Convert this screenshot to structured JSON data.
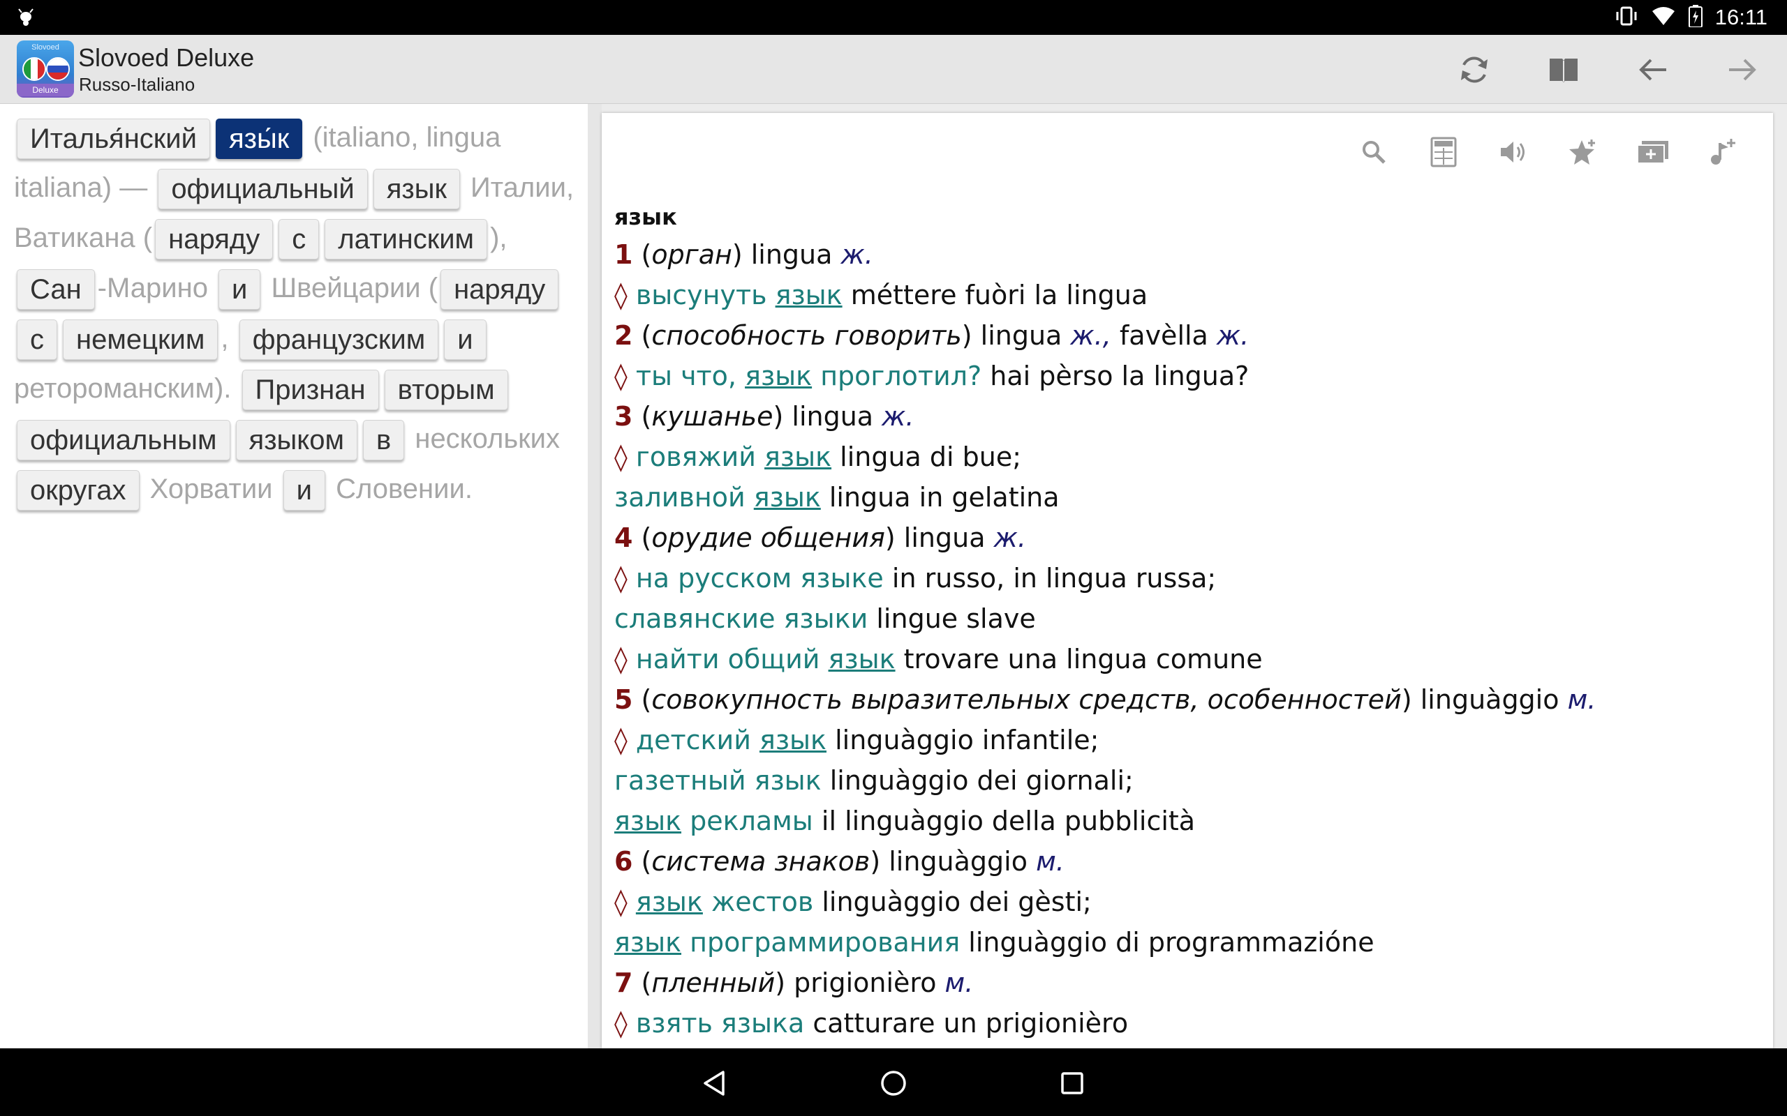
{
  "status_bar": {
    "time": "16:11"
  },
  "app_bar": {
    "icon_top_text": "Slovoed",
    "icon_bottom_text": "Deluxe",
    "title": "Slovoed Deluxe",
    "subtitle": "Russo-Italiano"
  },
  "source": {
    "t1": "Италья́нский",
    "t2": "язы́к",
    "t3": " (italiano, lingua italiana) — ",
    "t4": "официальный",
    "t5": "язык",
    "t6": " Италии, Ватикана (",
    "t7": "наряду",
    "t8": "с",
    "t9": "латинским",
    "t10": "), ",
    "t11": "Сан",
    "t12": "-Марино ",
    "t13": "и",
    "t14": " Швейцарии (",
    "t15": "наряду",
    "t16": "с",
    "t17": "немецким",
    "t18": ", ",
    "t19": "французским",
    "t20": "и",
    "t21": " ретороманским). ",
    "t22": "Признан",
    "t23": "вторым",
    "t24": "официальным",
    "t25": "языком",
    "t26": "в",
    "t27": " нескольких ",
    "t28": "округах",
    "t29": " Хорватии ",
    "t30": "и",
    "t31": " Словении."
  },
  "entry": {
    "headword": "язык",
    "l1": {
      "num": "1",
      "open": " (",
      "gloss": "орган",
      "close": ") lingua ",
      "gram": "ж."
    },
    "l2": {
      "dia": "◊ ",
      "ru1": "высунуть ",
      "ru_ul": "язык",
      "it": " méttere fuòri la lingua"
    },
    "l3": {
      "num": "2",
      "open": " (",
      "gloss": "способность говорить",
      "close": ") lingua ",
      "gram": "ж.,",
      "mid": " favèlla ",
      "gram2": "ж."
    },
    "l4": {
      "dia": "◊ ",
      "ru1": "ты что, ",
      "ru_ul": "язык",
      "ru2": " проглотил?",
      "it": " hai pèrso la lingua?"
    },
    "l5": {
      "num": "3",
      "open": " (",
      "gloss": "кушанье",
      "close": ") lingua ",
      "gram": "ж."
    },
    "l6": {
      "dia": "◊ ",
      "ru1": "говяжий ",
      "ru_ul": "язык",
      "it": " lingua di bue;"
    },
    "l7": {
      "ru1": "заливной ",
      "ru_ul": "язык",
      "it": " lingua in gelatina"
    },
    "l8": {
      "num": "4",
      "open": " (",
      "gloss": "орудие общения",
      "close": ") lingua ",
      "gram": "ж."
    },
    "l9": {
      "dia": "◊ ",
      "ru1": "на русском языке",
      "it": " in russo, in lingua russa;"
    },
    "l10": {
      "ru1": "славянские языки",
      "it": " lingue slave"
    },
    "l11": {
      "dia": "◊ ",
      "ru1": "найти общий ",
      "ru_ul": "язык",
      "it": " trovare una lingua comune"
    },
    "l12": {
      "num": "5",
      "open": " (",
      "gloss": "совокупность выразительных средств, особенностей",
      "close": ") linguàggio ",
      "gram": "м."
    },
    "l13": {
      "dia": "◊ ",
      "ru1": "детский ",
      "ru_ul": "язык",
      "it": " linguàggio infantile;"
    },
    "l14": {
      "ru1": "газетный язык",
      "it": " linguàggio dei giornali;"
    },
    "l15": {
      "ru_ul": "язык",
      "ru2": " рекламы",
      "it": " il linguàggio della pubblicità"
    },
    "l16": {
      "num": "6",
      "open": " (",
      "gloss": "система знаков",
      "close": ") linguàggio ",
      "gram": "м."
    },
    "l17": {
      "dia": "◊ ",
      "ru_ul": "язык",
      "ru2": " жестов",
      "it": " linguàggio dei gèsti;"
    },
    "l18": {
      "ru_ul": "язык",
      "ru2": " программирования",
      "it": " linguàggio di programmazióne"
    },
    "l19": {
      "num": "7",
      "open": " (",
      "gloss": "пленный",
      "close": ") prigionièro ",
      "gram": "м."
    },
    "l20": {
      "dia": "◊ ",
      "ru1": "взять языка",
      "it": " catturare un prigionièro"
    }
  },
  "colors": {
    "chip_active": "#0c3276",
    "sense_number": "#7b1010",
    "russian_phrase": "#1b7d7a",
    "grammar": "#1c1c6e",
    "dimmed_text": "#a6a6a6"
  },
  "icons": {
    "app_bar": [
      "sync-icon",
      "book-icon",
      "back-arrow-icon",
      "forward-arrow-icon"
    ],
    "toolbar": [
      "search-icon",
      "calculator-icon",
      "speaker-icon",
      "favorite-add-icon",
      "cards-add-icon",
      "music-note-add-icon"
    ],
    "navigation": [
      "back-triangle-icon",
      "home-circle-icon",
      "recents-square-icon"
    ]
  }
}
